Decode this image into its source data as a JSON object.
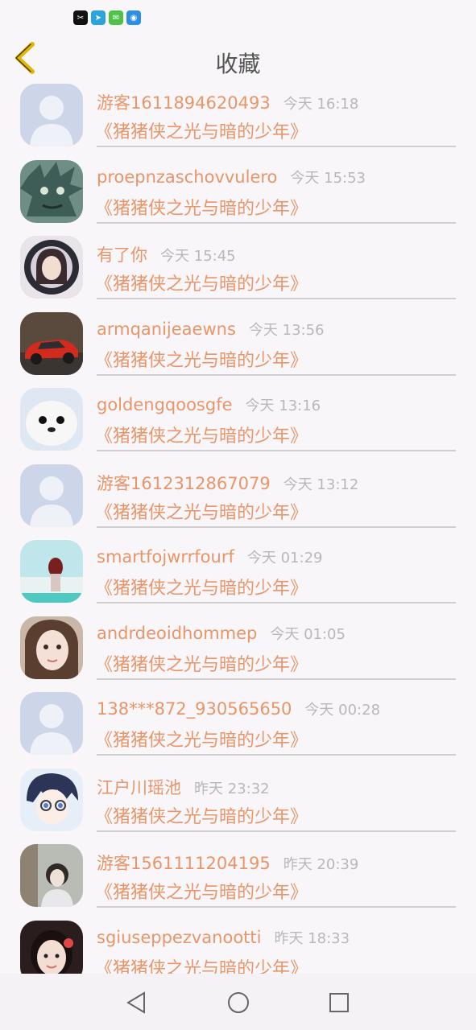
{
  "status_bar": {
    "icons": [
      "capcut-icon",
      "telegram-icon",
      "wechat-icon",
      "hotspot-icon"
    ]
  },
  "header": {
    "title": "收藏",
    "back_icon": "chevron-left-icon"
  },
  "colors": {
    "accent": "#e8956a",
    "time": "#b8b8b8",
    "divider": "#cfcfcf",
    "back_arrow": "#e0b800"
  },
  "favorites": [
    {
      "username": "游客1611894620493",
      "time": "今天 16:18",
      "title": "《猪猪侠之光与暗的少年》",
      "avatar": "default-avatar"
    },
    {
      "username": "proepnzaschovvulero",
      "time": "今天 15:53",
      "title": "《猪猪侠之光与暗的少年》",
      "avatar": "green-monster-avatar"
    },
    {
      "username": "有了你",
      "time": "今天 15:45",
      "title": "《猪猪侠之光与暗的少年》",
      "avatar": "girl-portrait-avatar"
    },
    {
      "username": "armqanijeaewns",
      "time": "今天 13:56",
      "title": "《猪猪侠之光与暗的少年》",
      "avatar": "red-car-avatar"
    },
    {
      "username": "goldengqoosgfe",
      "time": "今天 13:16",
      "title": "《猪猪侠之光与暗的少年》",
      "avatar": "seal-avatar"
    },
    {
      "username": "游客1612312867079",
      "time": "今天 13:12",
      "title": "《猪猪侠之光与暗的少年》",
      "avatar": "default-avatar"
    },
    {
      "username": "smartfojwrrfourf",
      "time": "今天 01:29",
      "title": "《猪猪侠之光与暗的少年》",
      "avatar": "beach-girl-avatar"
    },
    {
      "username": "andrdeoidhommep",
      "time": "今天 01:05",
      "title": "《猪猪侠之光与暗的少年》",
      "avatar": "woman-face-avatar"
    },
    {
      "username": "138***872_930565650",
      "time": "今天 00:28",
      "title": "《猪猪侠之光与暗的少年》",
      "avatar": "default-avatar"
    },
    {
      "username": "江户川瑶池",
      "time": "昨天 23:32",
      "title": "《猪猪侠之光与暗的少年》",
      "avatar": "anime-boy-avatar"
    },
    {
      "username": "游客1561111204195",
      "time": "昨天 20:39",
      "title": "《猪猪侠之光与暗的少年》",
      "avatar": "woman-outdoor-avatar"
    },
    {
      "username": "sgiuseppezvanootti",
      "time": "昨天 18:33",
      "title": "《猪猪侠之光与暗的少年》",
      "avatar": "child-avatar"
    }
  ],
  "nav_bar": {
    "back": "triangle-back-icon",
    "home": "circle-home-icon",
    "recents": "square-recents-icon"
  }
}
